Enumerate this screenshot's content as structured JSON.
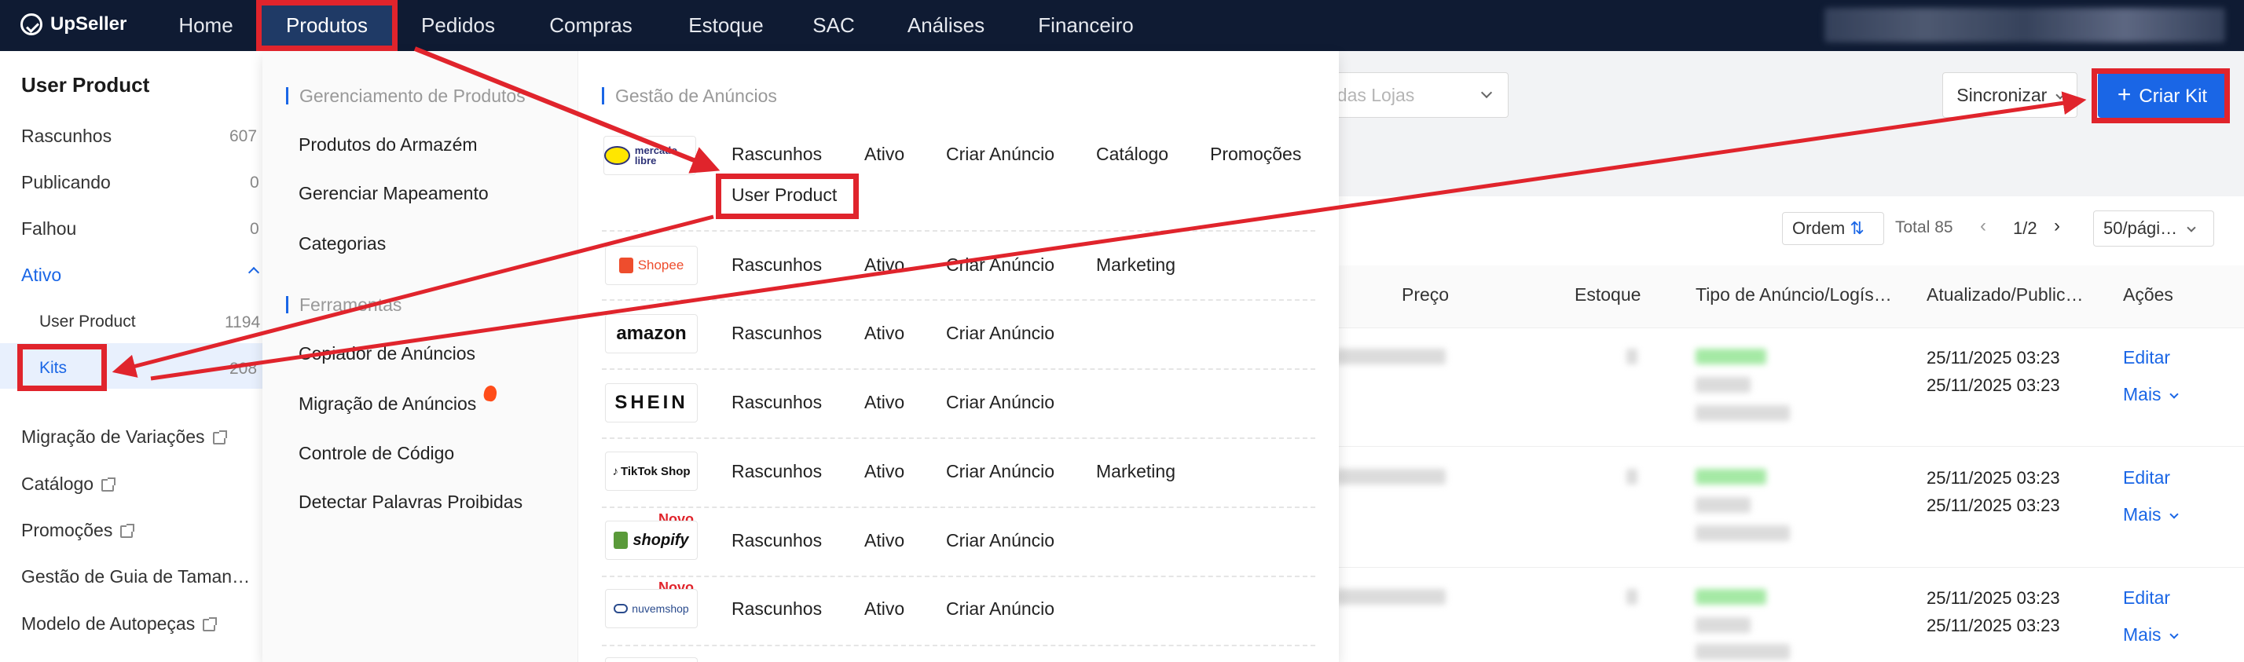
{
  "nav": {
    "brand": "UpSeller",
    "items": [
      "Home",
      "Produtos",
      "Pedidos",
      "Compras",
      "Estoque",
      "SAC",
      "Análises",
      "Financeiro"
    ]
  },
  "sidebar": {
    "title": "User Product",
    "items": [
      {
        "label": "Rascunhos",
        "count": "607"
      },
      {
        "label": "Publicando",
        "count": "0"
      },
      {
        "label": "Falhou",
        "count": "0"
      },
      {
        "label": "Ativo",
        "count": ""
      }
    ],
    "sub": [
      {
        "label": "User Product",
        "count": "1194"
      },
      {
        "label": "Kits",
        "count": "208"
      }
    ],
    "links": [
      "Migração de Variações",
      "Catálogo",
      "Promoções",
      "Gestão de Guia de Taman…",
      "Modelo de Autopeças"
    ]
  },
  "mega": {
    "left_section1": "Gerenciamento de Produtos",
    "left_links1": [
      "Produtos do Armazém",
      "Gerenciar Mapeamento",
      "Categorias"
    ],
    "left_section2": "Ferramentas",
    "left_links2": [
      "Copiador de Anúncios",
      "Migração de Anúncios",
      "Controle de Código",
      "Detectar Palavras Proibidas"
    ],
    "right_section": "Gestão de Anúncios",
    "novo": "Novo",
    "platforms": [
      {
        "logo": "mercado libre",
        "ops": [
          "Rascunhos",
          "Ativo",
          "Criar Anúncio",
          "Catálogo",
          "Promoções"
        ],
        "extra": "User Product"
      },
      {
        "logo": "Shopee",
        "ops": [
          "Rascunhos",
          "Ativo",
          "Criar Anúncio",
          "Marketing"
        ]
      },
      {
        "logo": "amazon",
        "ops": [
          "Rascunhos",
          "Ativo",
          "Criar Anúncio"
        ]
      },
      {
        "logo": "SHEIN",
        "ops": [
          "Rascunhos",
          "Ativo",
          "Criar Anúncio"
        ]
      },
      {
        "logo": "TikTok Shop",
        "ops": [
          "Rascunhos",
          "Ativo",
          "Criar Anúncio",
          "Marketing"
        ]
      },
      {
        "logo": "shopify",
        "ops": [
          "Rascunhos",
          "Ativo",
          "Criar Anúncio"
        ]
      },
      {
        "logo": "nuvemshop",
        "ops": [
          "Rascunhos",
          "Ativo",
          "Criar Anúncio"
        ]
      }
    ]
  },
  "main": {
    "store_filter": "odas Lojas",
    "sync_label": "Sincronizar",
    "create_kit_label": "Criar Kit",
    "ordem_label": "Ordem",
    "total_label": "Total 85",
    "page_label": "1/2",
    "page_size": "50/pági…",
    "columns": [
      "Preço",
      "Estoque",
      "Tipo de Anúncio/Logís…",
      "Atualizado/Public…",
      "Ações"
    ],
    "rows": [
      {
        "updated": "25/11/2025 03:23",
        "published": "25/11/2025 03:23",
        "edit": "Editar",
        "more": "Mais"
      },
      {
        "updated": "25/11/2025 03:23",
        "published": "25/11/2025 03:23",
        "edit": "Editar",
        "more": "Mais"
      },
      {
        "updated": "25/11/2025 03:23",
        "published": "25/11/2025 03:23",
        "edit": "Editar",
        "more": "Mais"
      }
    ]
  },
  "colors": {
    "nav_bg": "#0f1b33",
    "accent": "#1a66e6",
    "annotation": "#e0242c"
  }
}
